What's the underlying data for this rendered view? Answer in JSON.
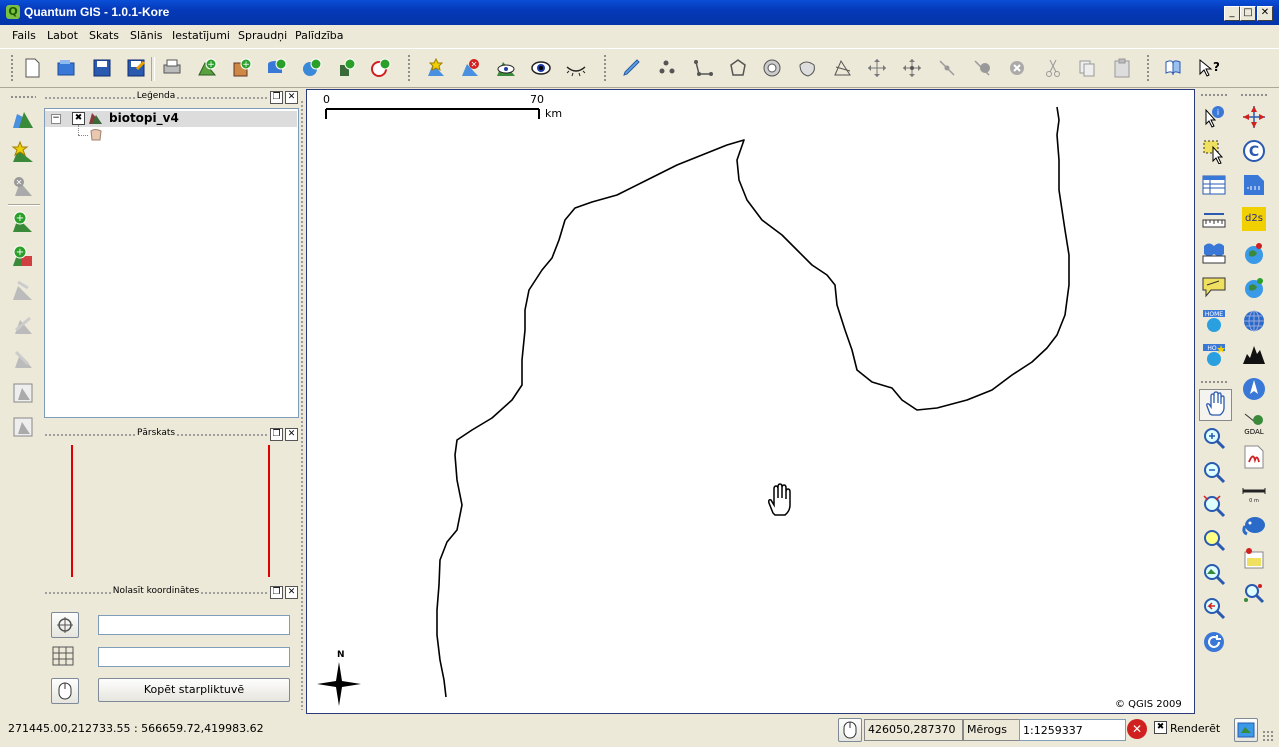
{
  "window": {
    "title": "Quantum GIS - 1.0.1-Kore"
  },
  "menu": [
    "Fails",
    "Labot",
    "Skats",
    "Slānis",
    "Iestatījumi",
    "Spraudņi",
    "Palīdzība"
  ],
  "legend_panel": {
    "title": "Leģenda",
    "layer_name": "biotopi_v4"
  },
  "overview_panel": {
    "title": "Pārskats"
  },
  "coord_panel": {
    "title": "Nolasīt koordinātes",
    "copy_button": "Kopēt starpliktuvē",
    "field1": "",
    "field2": ""
  },
  "map": {
    "scalebar_start": "0",
    "scalebar_end": "70",
    "scalebar_unit": "km",
    "north_label": "N",
    "copyright": "© QGIS 2009"
  },
  "status": {
    "extent": "271445.00,212733.55 : 566659.72,419983.62",
    "coords": "426050,287370",
    "scale_label": "Mērogs",
    "scale_value": "1:1259337",
    "render_label": "Renderēt"
  },
  "colors": {
    "titlebar": "#0539b8",
    "chrome": "#ece9d8",
    "overview_line": "#e00000"
  }
}
